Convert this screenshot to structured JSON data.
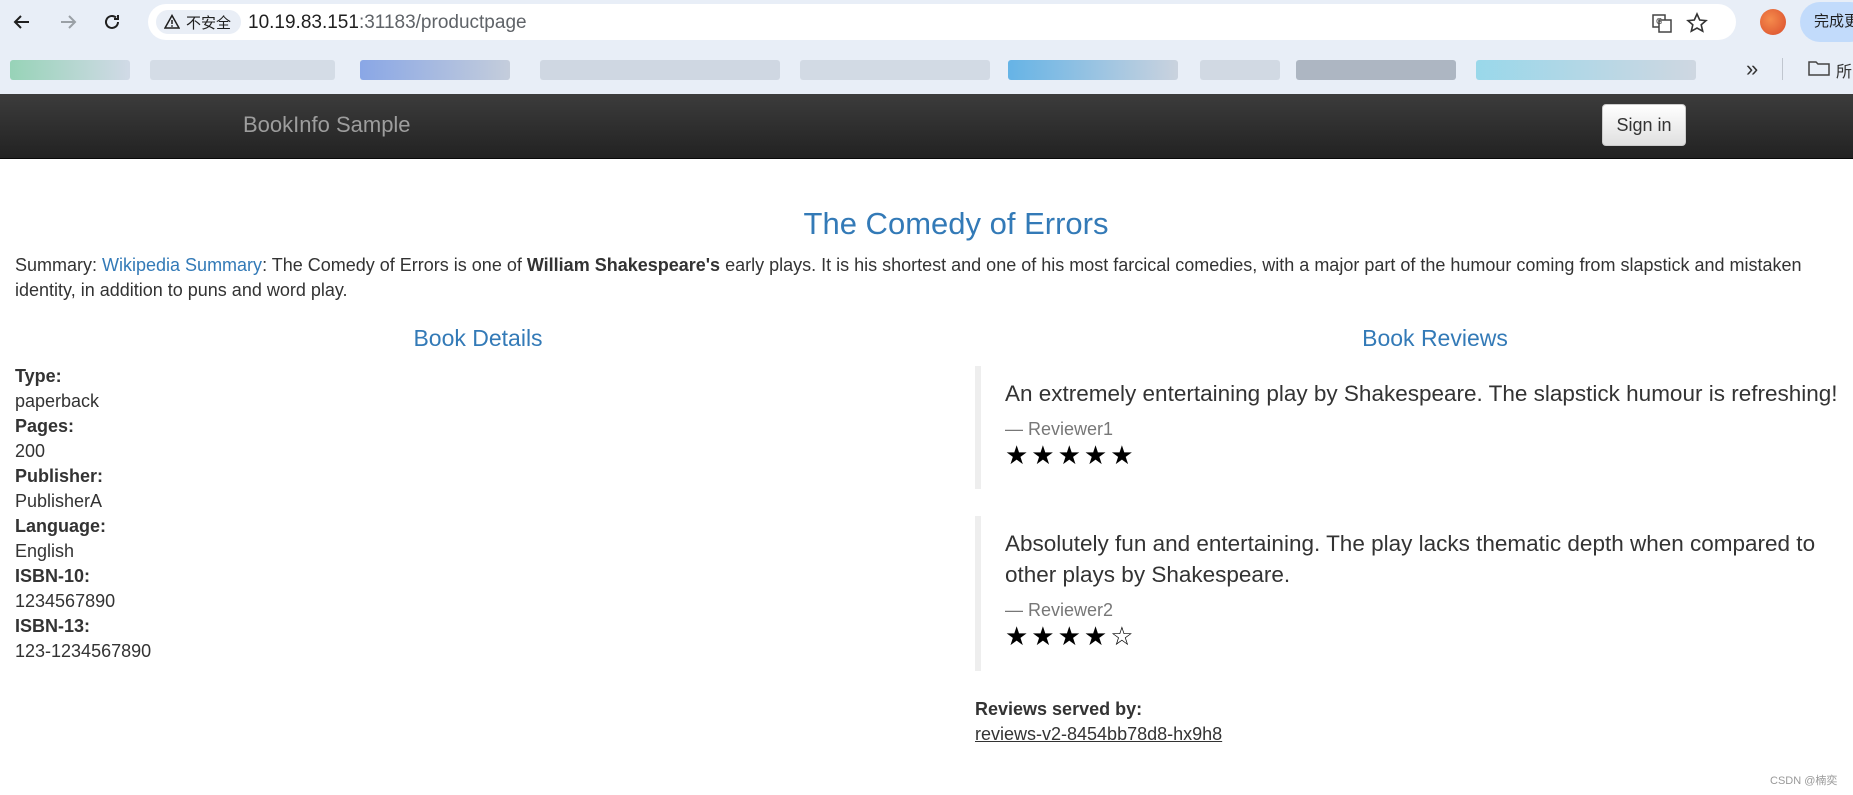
{
  "browser": {
    "security_label": "不安全",
    "url_host": "10.19.83.151",
    "url_rest": ":31183/productpage",
    "profile_label": "完成更",
    "bookmarks_folder_label": "所"
  },
  "navbar": {
    "brand": "BookInfo Sample",
    "signin_label": "Sign in"
  },
  "product": {
    "title": "The Comedy of Errors",
    "summary_prefix": "Summary: ",
    "summary_link": "Wikipedia Summary",
    "summary_text1": ": The Comedy of Errors is one of ",
    "summary_bold": "William Shakespeare's",
    "summary_text2": " early plays. It is his shortest and one of his most farcical comedies, with a major part of the humour coming from slapstick and mistaken identity, in addition to puns and word play."
  },
  "details": {
    "heading": "Book Details",
    "items": [
      {
        "label": "Type:",
        "value": "paperback"
      },
      {
        "label": "Pages:",
        "value": "200"
      },
      {
        "label": "Publisher:",
        "value": "PublisherA"
      },
      {
        "label": "Language:",
        "value": "English"
      },
      {
        "label": "ISBN-10:",
        "value": "1234567890"
      },
      {
        "label": "ISBN-13:",
        "value": "123-1234567890"
      }
    ]
  },
  "reviews": {
    "heading": "Book Reviews",
    "items": [
      {
        "text": "An extremely entertaining play by Shakespeare. The slapstick humour is refreshing!",
        "reviewer": "— Reviewer1",
        "stars": "★★★★★",
        "rating": 5
      },
      {
        "text": "Absolutely fun and entertaining. The play lacks thematic depth when compared to other plays by Shakespeare.",
        "reviewer": "— Reviewer2",
        "stars": "★★★★☆",
        "rating": 4
      }
    ],
    "served_by_label": "Reviews served by:",
    "served_by_pod": "reviews-v2-8454bb78d8-hx9h8"
  },
  "watermark": "CSDN @楠奕"
}
